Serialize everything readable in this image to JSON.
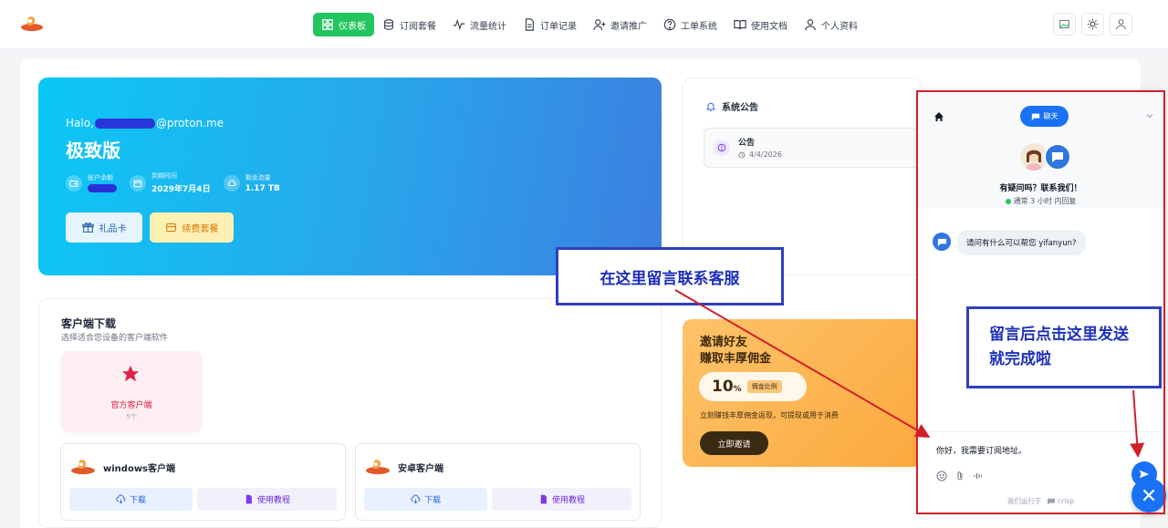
{
  "nav": {
    "items": [
      {
        "label": "仪表板",
        "icon": "dashboard-icon",
        "active": true
      },
      {
        "label": "订阅套餐",
        "icon": "database-icon"
      },
      {
        "label": "流量统计",
        "icon": "activity-icon"
      },
      {
        "label": "订单记录",
        "icon": "document-icon"
      },
      {
        "label": "邀请推广",
        "icon": "user-plus-icon"
      },
      {
        "label": "工单系统",
        "icon": "help-circle-icon"
      },
      {
        "label": "使用文档",
        "icon": "book-icon"
      },
      {
        "label": "个人资料",
        "icon": "user-icon"
      }
    ]
  },
  "hero": {
    "hello_prefix": "Halo,",
    "email_domain": "@proton.me",
    "plan": "极致版",
    "stats": {
      "balance_label": "账户余额",
      "expire_label": "到期时间",
      "expire_value": "2029年7月4日",
      "traffic_label": "剩余流量",
      "traffic_value": "1.17 TB"
    },
    "gift_label": "礼品卡",
    "renew_label": "续费套餐"
  },
  "notice": {
    "title": "系统公告",
    "item_title": "公告",
    "item_date": "4/4/2026"
  },
  "clients": {
    "title": "客户端下载",
    "subtitle": "选择适合您设备的客户端软件",
    "official_label": "官方客户端",
    "official_count": "5个",
    "cards": [
      {
        "name": "windows客户端",
        "download": "下载",
        "tutorial": "使用教程"
      },
      {
        "name": "安卓客户端",
        "download": "下载",
        "tutorial": "使用教程"
      }
    ]
  },
  "invite": {
    "line1": "邀请好友",
    "line2": "赚取丰厚佣金",
    "rate": "10",
    "rate_unit": "%",
    "rate_tag": "佣金比例",
    "desc": "立刻赚钱丰厚佣金返现，可提现或用于消费",
    "button": "立即邀请"
  },
  "chat": {
    "tab_label": "聊天",
    "question": "有疑问吗？联系我们！",
    "eta": "通常 3 小时 内回复",
    "message": "请问有什么可以帮您 yifanyun?",
    "input_value": "你好，我需要订阅地址。",
    "footer_prefix": "我们运行于",
    "footer_brand": "crisp"
  },
  "annotations": {
    "left_note": "在这里留言联系客服",
    "right_note": "留言后点击这里发送就完成啦"
  },
  "colors": {
    "accent_green": "#22c55e",
    "hero_start": "#0bc8f6",
    "hero_end": "#3c7fe0",
    "chat_blue": "#1972f5",
    "annotation_red": "#d0202a",
    "annotation_blue": "#2f3fbf"
  }
}
